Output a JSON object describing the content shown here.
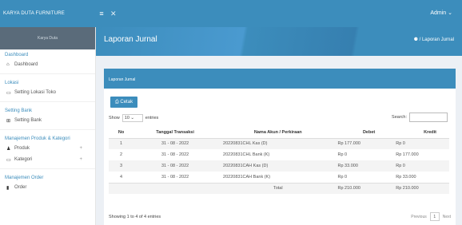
{
  "topbar": {
    "brand": "KARYA DUTA FURNITURE",
    "admin": "Admin"
  },
  "sidebar": {
    "user_panel": "Karya Duta",
    "sections": [
      {
        "title": "Dashboard",
        "items": [
          {
            "label": "Dashboard",
            "icon": "home-icon",
            "expandable": false
          }
        ]
      },
      {
        "title": "Lokasi",
        "items": [
          {
            "label": "Setting Lokasi Toko",
            "icon": "monitor-icon",
            "expandable": false
          }
        ]
      },
      {
        "title": "Setting Bank",
        "items": [
          {
            "label": "Setting Bank",
            "icon": "bank-icon",
            "expandable": false
          }
        ]
      },
      {
        "title": "Manajemen Produk & Kategori",
        "items": [
          {
            "label": "Produk",
            "icon": "users-icon",
            "expandable": true
          },
          {
            "label": "Kategori",
            "icon": "monitor-icon",
            "expandable": true
          }
        ]
      },
      {
        "title": "Manajemen Order",
        "items": [
          {
            "label": "Order",
            "icon": "doc-icon",
            "expandable": false
          }
        ]
      }
    ]
  },
  "header": {
    "title": "Laporan Jurnal",
    "breadcrumb": "/ Laporan Jurnal"
  },
  "box": {
    "title": "Laporan Jurnal",
    "print_label": "Cetak"
  },
  "table_controls": {
    "show_label": "Show",
    "show_value": "10",
    "entries_label": "entries",
    "search_label": "Search:"
  },
  "table": {
    "headers": [
      "No",
      "Tanggal Transaksi",
      "Nama Akun / Perkiraan",
      "Debet",
      "Kredit"
    ],
    "rows": [
      [
        "1",
        "31 - 08 - 2022",
        "20220831CHL Kas (D)",
        "Rp 177.000",
        "Rp 0"
      ],
      [
        "2",
        "31 - 08 - 2022",
        "20220831CHL Bank (K)",
        "Rp 0",
        "Rp 177.000"
      ],
      [
        "3",
        "31 - 08 - 2022",
        "20220831CAH Kas (D)",
        "Rp 33.000",
        "Rp 0"
      ],
      [
        "4",
        "31 - 08 - 2022",
        "20220831CAH Bank (K)",
        "Rp 0",
        "Rp 33.000"
      ]
    ],
    "total": {
      "label": "Total",
      "debet": "Rp 210.000",
      "kredit": "Rp 210.000"
    }
  },
  "footer": {
    "info": "Showing 1 to 4 of 4 entries",
    "previous": "Previous",
    "page": "1",
    "next": "Next"
  },
  "colors": {
    "primary": "#3c8dbc",
    "background": "#ecf0f5"
  }
}
